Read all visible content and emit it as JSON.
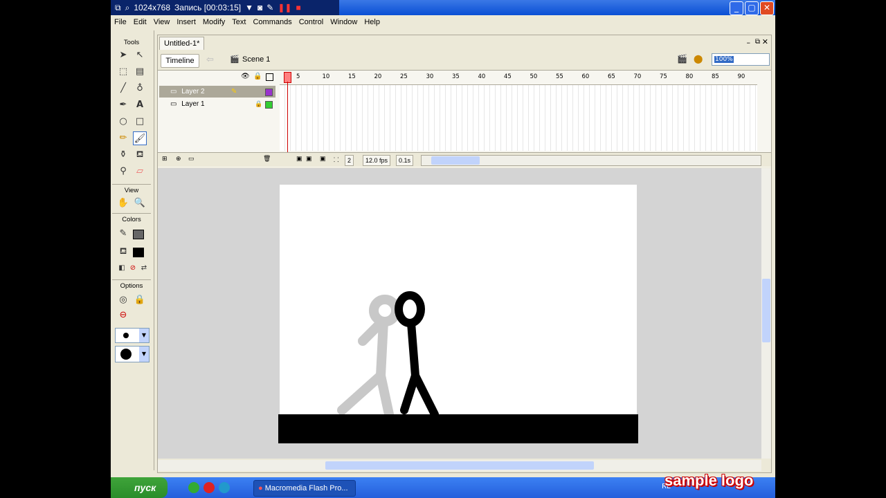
{
  "recorder": {
    "resolution": "1024x768",
    "status": "Запись [00:03:15]"
  },
  "menu": [
    "File",
    "Edit",
    "View",
    "Insert",
    "Modify",
    "Text",
    "Commands",
    "Control",
    "Window",
    "Help"
  ],
  "tools_panel": {
    "title": "Tools",
    "view_label": "View",
    "colors_label": "Colors",
    "options_label": "Options"
  },
  "document": {
    "tab": "Untitled-1*",
    "timeline_button": "Timeline",
    "scene": "Scene 1",
    "zoom": "100%"
  },
  "timeline": {
    "layers": [
      {
        "name": "Layer 2",
        "color": "#9933cc"
      },
      {
        "name": "Layer 1",
        "color": "#33cc33"
      }
    ],
    "ruler": [
      "5",
      "10",
      "15",
      "20",
      "25",
      "30",
      "35",
      "40",
      "45",
      "50",
      "55",
      "60",
      "65",
      "70",
      "75",
      "80",
      "85",
      "90"
    ],
    "current_frame": "2",
    "fps": "12.0 fps",
    "time": "0.1s"
  },
  "taskbar": {
    "start": "пуск",
    "task": "Macromedia Flash Pro...",
    "locale": "RL"
  },
  "watermark": "sample logo"
}
